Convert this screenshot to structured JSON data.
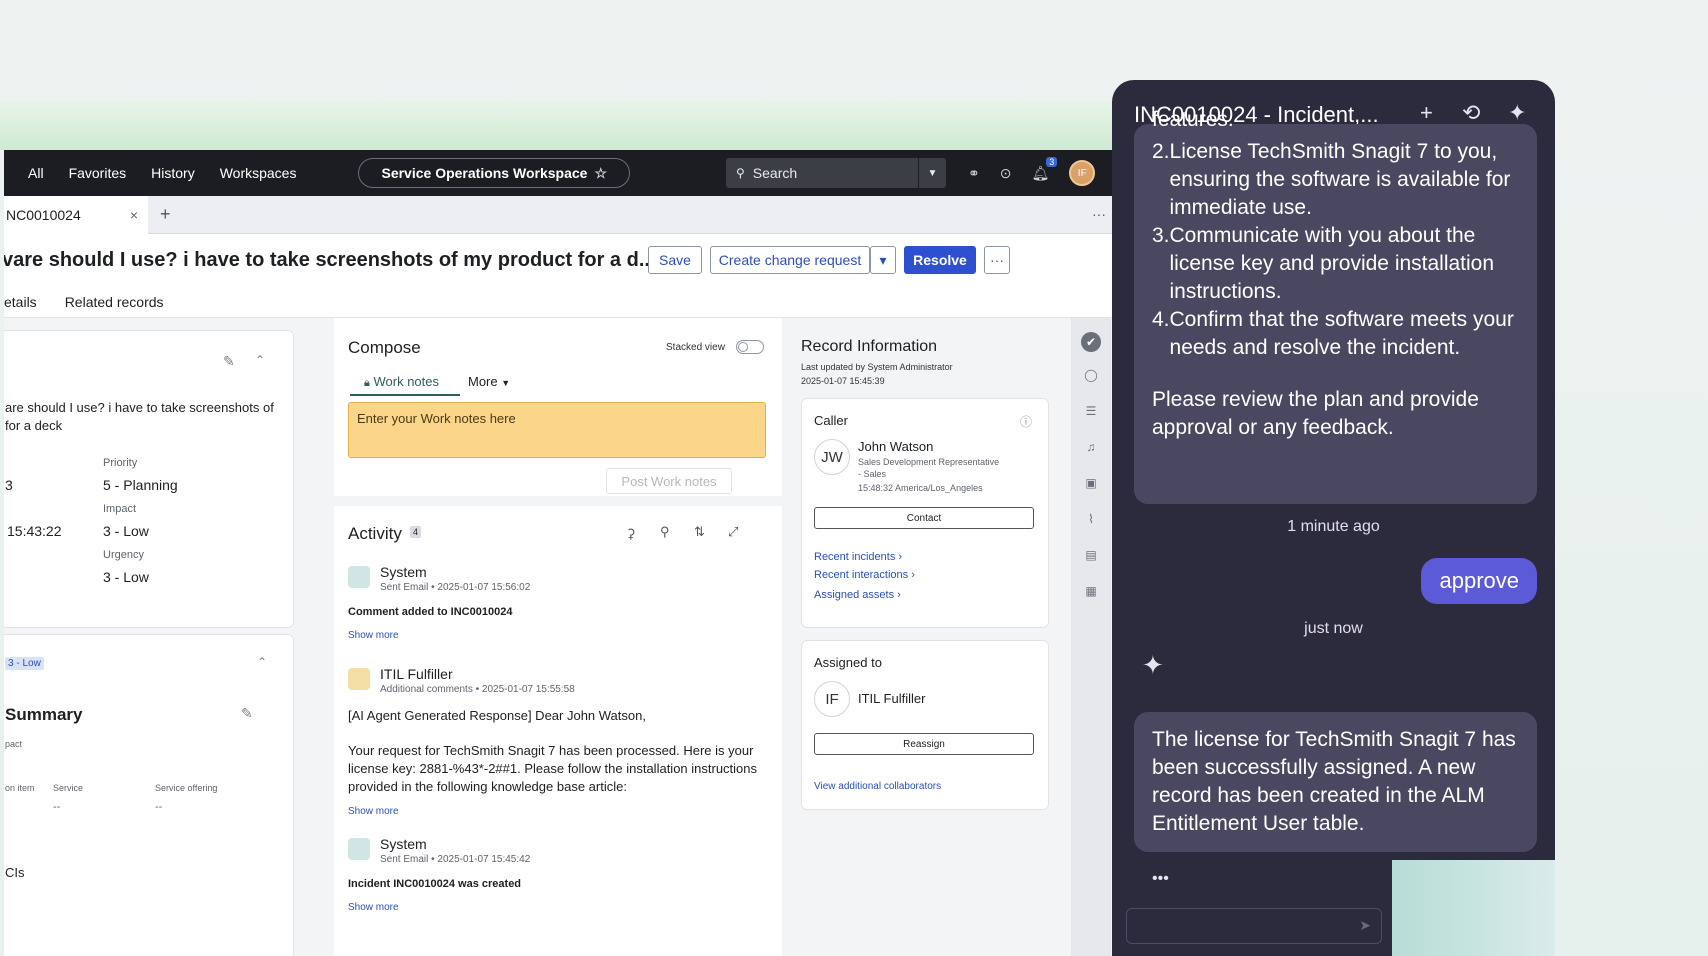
{
  "topbar": {
    "nav": [
      "All",
      "Favorites",
      "History",
      "Workspaces"
    ],
    "workspace": "Service Operations Workspace",
    "search_placeholder": "Search",
    "bell_count": "3",
    "avatar": "IF"
  },
  "tab": {
    "label": "NC0010024",
    "close": "×",
    "add": "+",
    "more": "···"
  },
  "record": {
    "title": "vare should I use? i have to take screenshots of my product for a d...",
    "buttons": {
      "save": "Save",
      "create_change": "Create change request",
      "resolve": "Resolve",
      "more": "···"
    },
    "tabs": [
      "etails",
      "Related records"
    ]
  },
  "left": {
    "description": "are should I use? i have to take screenshots of for a deck",
    "fields": [
      {
        "label": "Priority",
        "value": "5 - Planning",
        "left_value": "3"
      },
      {
        "label": "Impact",
        "value": "3 - Low",
        "left_value": "15:43:22"
      },
      {
        "label": "Urgency",
        "value": "3 - Low",
        "left_value": ""
      }
    ],
    "badge": "3 - Low",
    "summary_title": "Summary",
    "summary_sub": "pact",
    "summary_cols": [
      "on item",
      "Service",
      "Service offering"
    ],
    "summary_vals": [
      "--",
      "--"
    ],
    "cis": "CIs"
  },
  "compose": {
    "title": "Compose",
    "stacked": "Stacked view",
    "tab_work": "Work notes",
    "tab_more": "More",
    "placeholder": "Enter your Work notes here",
    "post": "Post Work notes"
  },
  "activity": {
    "title": "Activity",
    "count": "4",
    "items": [
      {
        "name": "System",
        "meta": "Sent Email • 2025-01-07 15:56:02",
        "body": "Comment added to INC0010024",
        "more": "Show more"
      },
      {
        "name": "ITIL Fulfiller",
        "meta": "Additional comments • 2025-01-07 15:55:58",
        "body1": "[AI Agent Generated Response] Dear John Watson,",
        "body2": "Your request for TechSmith Snagit 7 has been processed. Here is your license key: 2881-%43*-2##1. Please follow the installation instructions provided in the following knowledge base article:",
        "more": "Show more"
      },
      {
        "name": "System",
        "meta": "Sent Email • 2025-01-07 15:45:42",
        "body": "Incident INC0010024 was created",
        "more": "Show more"
      }
    ]
  },
  "record_info": {
    "title": "Record Information",
    "updated": "Last updated by System Administrator",
    "date": "2025-01-07 15:45:39",
    "caller_label": "Caller",
    "caller_initials": "JW",
    "caller_name": "John Watson",
    "caller_role": "Sales Development Representative",
    "caller_dept": "- Sales",
    "caller_time": "15:48:32 America/Los_Angeles",
    "contact": "Contact",
    "links": [
      "Recent incidents",
      "Recent interactions",
      "Assigned assets"
    ],
    "assigned_label": "Assigned to",
    "assigned_initials": "IF",
    "assigned_name": "ITIL Fulfiller",
    "reassign": "Reassign",
    "collab": "View additional collaborators"
  },
  "chat": {
    "title": "INC0010024 - Incident,...",
    "cut_line": "features.",
    "plan": [
      {
        "n": "2.",
        "text": "License TechSmith Snagit 7 to you, ensuring the software is available for immediate use."
      },
      {
        "n": "3.",
        "text": "Communicate with you about the license key and provide installation instructions."
      },
      {
        "n": "4.",
        "text": "Confirm that the software meets your needs and resolve the incident."
      }
    ],
    "review": "Please review the plan and provide approval or any feedback.",
    "time1": "1 minute ago",
    "user_msg": "approve",
    "time2": "just now",
    "reply": "The license for TechSmith Snagit 7 has been successfully assigned. A new record has been created in the ALM Entitlement User table.",
    "typing": "•••"
  }
}
